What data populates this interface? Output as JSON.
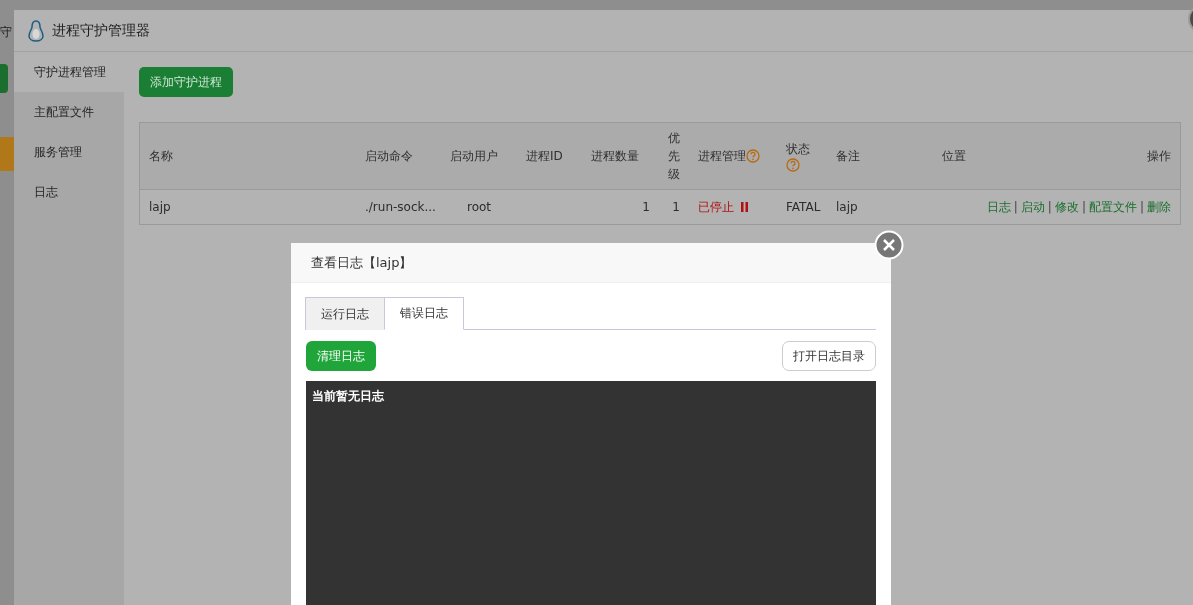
{
  "background_page": {
    "header_text": "守"
  },
  "window": {
    "title": "进程守护管理器"
  },
  "sidebar": {
    "items": [
      {
        "label": "守护进程管理",
        "selected": true
      },
      {
        "label": "主配置文件",
        "selected": false
      },
      {
        "label": "服务管理",
        "selected": false
      },
      {
        "label": "日志",
        "selected": false
      }
    ]
  },
  "add_button": "添加守护进程",
  "table": {
    "columns": [
      {
        "label": "名称",
        "help": false
      },
      {
        "label": "启动命令",
        "help": false
      },
      {
        "label": "启动用户",
        "help": false
      },
      {
        "label": "进程ID",
        "help": false
      },
      {
        "label": "进程数量",
        "help": false
      },
      {
        "label": "优先级",
        "help": false
      },
      {
        "label": "进程管理",
        "help": true
      },
      {
        "label": "状态",
        "help": true
      },
      {
        "label": "备注",
        "help": false
      },
      {
        "label": "位置",
        "help": false
      },
      {
        "label": "操作",
        "help": false
      }
    ],
    "rows": [
      {
        "name": "lajp",
        "command": "./run-sock...",
        "user": "root",
        "pid": "",
        "count": "1",
        "priority": "1",
        "manage": "已停止",
        "stopped": true,
        "status": "FATAL",
        "note": "lajp",
        "actions": [
          "日志",
          "启动",
          "修改",
          "配置文件",
          "删除"
        ],
        "separator": "|"
      }
    ]
  },
  "dialog": {
    "title": "查看日志【lajp】",
    "tabs": [
      {
        "label": "运行日志",
        "selected": false
      },
      {
        "label": "错误日志",
        "selected": true
      }
    ],
    "clear_button": "清理日志",
    "open_dir_button": "打开日志目录",
    "log_text": "当前暂无日志"
  }
}
